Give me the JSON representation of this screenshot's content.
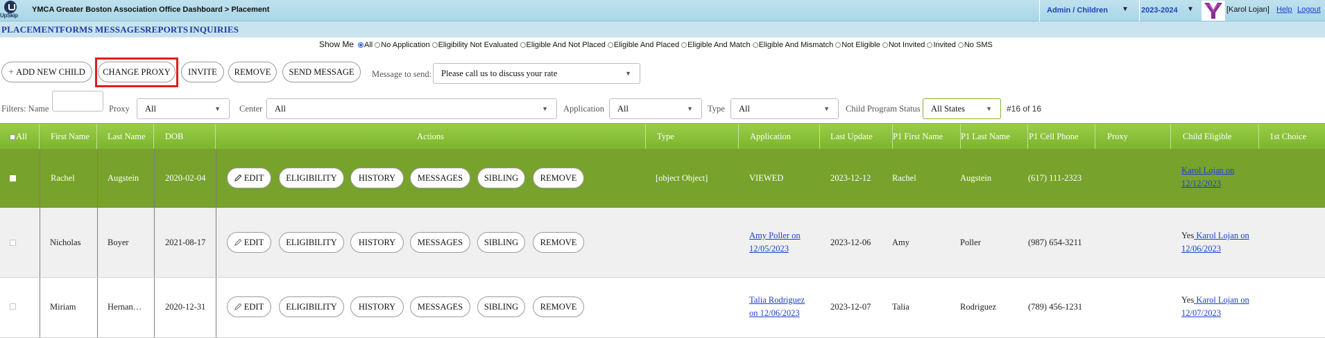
{
  "logo_text": "UpSkip",
  "header": {
    "title": "YMCA Greater Boston Association Office Dashboard > Placement",
    "role_select": "Admin / Children",
    "year_select": "2023-2024",
    "user": "[Karol Lojan]",
    "help": "Help",
    "logout": "Logout"
  },
  "nav": [
    "PLACEMENT",
    "FORMS",
    "MESSAGES",
    "REPORTS",
    "INQUIRIES"
  ],
  "show_me": {
    "label": "Show Me",
    "options": [
      "All",
      "No Application",
      "Eligibility Not Evaluated",
      "Eligible And Not Placed",
      "Eligible And Placed",
      "Eligible And Match",
      "Eligible And Mismatch",
      "Not Eligible",
      "Not Invited",
      "Invited",
      "No SMS"
    ],
    "selected": "All"
  },
  "actions": {
    "add_child": "ADD NEW CHILD",
    "change_proxy": "CHANGE PROXY",
    "invite": "INVITE",
    "remove": "REMOVE",
    "send_message": "SEND MESSAGE",
    "message_label": "Message to send:",
    "message_value": "Please call us to discuss your rate"
  },
  "filters": {
    "name_label": "Filters: Name",
    "name_value": "",
    "proxy_label": "Proxy",
    "proxy_value": "All",
    "center_label": "Center",
    "center_value": "All",
    "application_label": "Application",
    "application_value": "All",
    "type_label": "Type",
    "type_value": "All",
    "status_label": "Child Program Status",
    "status_value": "All States",
    "count": "#16 of 16"
  },
  "columns": {
    "all": "All",
    "first": "First Name",
    "last": "Last Name",
    "dob": "DOB",
    "actions": "Actions",
    "type": "Type",
    "application": "Application",
    "last_update": "Last Update",
    "p1_first": "P1 First Name",
    "p1_last": "P1 Last Name",
    "p1_cell": "P1 Cell Phone",
    "proxy": "Proxy",
    "child_eligible": "Child Eligible",
    "first_choice": "1st Choice"
  },
  "row_buttons": {
    "edit": "EDIT",
    "eligibility": "ELIGIBILITY",
    "history": "HISTORY",
    "messages": "MESSAGES",
    "sibling": "SIBLING",
    "remove": "REMOVE"
  },
  "rows": [
    {
      "first": "Rachel",
      "last": "Augstein",
      "dob": "2020-02-04",
      "type": "[object Object]",
      "application": "VIEWED",
      "application_line2": "",
      "last_update": "2023-12-12",
      "p1_first": "Rachel",
      "p1_last": "Augstein",
      "p1_cell": "(617) 111-2323",
      "proxy": "",
      "eligible_prefix": "",
      "eligible_line1": "Karol Lojan on",
      "eligible_line2": "12/12/2023",
      "first_choice": ""
    },
    {
      "first": "Nicholas",
      "last": "Boyer",
      "dob": "2021-08-17",
      "type": "",
      "application": "Amy Poller on",
      "application_line2": "12/05/2023",
      "last_update": "2023-12-06",
      "p1_first": "Amy",
      "p1_last": "Poller",
      "p1_cell": "(987) 654-3211",
      "proxy": "",
      "eligible_prefix": "Yes",
      "eligible_line1": " Karol Lojan on",
      "eligible_line2": "12/06/2023",
      "first_choice": ""
    },
    {
      "first": "Miriam",
      "last": "Hernan…",
      "dob": "2020-12-31",
      "type": "",
      "application": "Talia Rodriguez",
      "application_line2": "on 12/06/2023",
      "last_update": "2023-12-07",
      "p1_first": "Talia",
      "p1_last": "Rodriguez",
      "p1_cell": "(789) 456-1231",
      "proxy": "",
      "eligible_prefix": "Yes",
      "eligible_line1": " Karol Lojan on",
      "eligible_line2": "12/07/2023",
      "first_choice": ""
    }
  ],
  "colors": {
    "header_bar": "#a9d6e8",
    "nav_link": "#1a3aa8",
    "table_header": "#8cc33a",
    "selected_row": "#77a22c",
    "highlight": "#e41c1c",
    "link": "#1a3fd0"
  }
}
